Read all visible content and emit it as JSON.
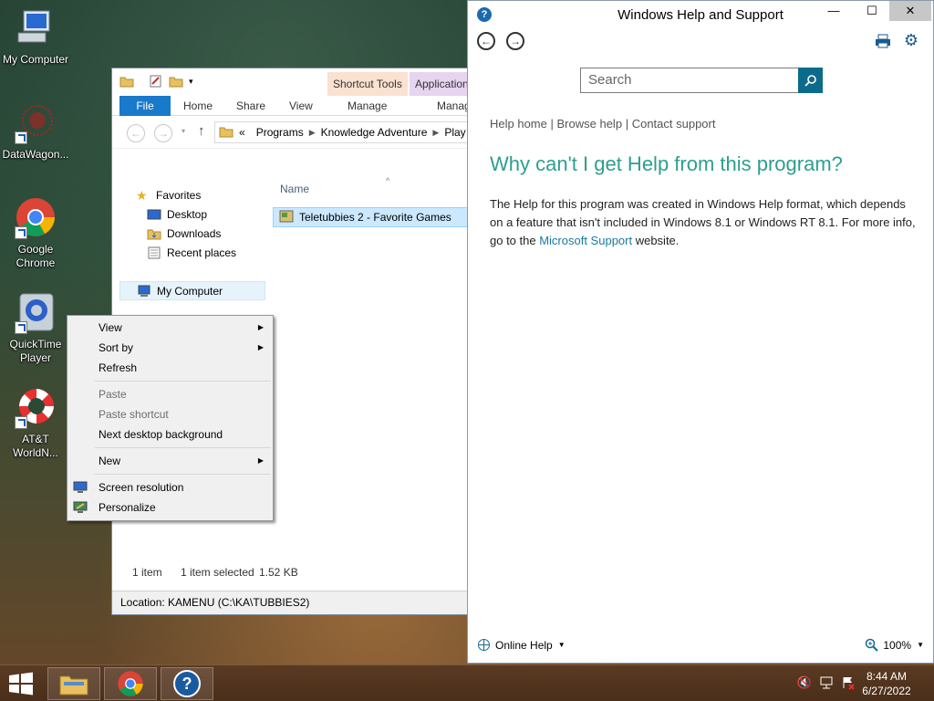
{
  "desktop": {
    "icons": [
      {
        "label": "My Computer",
        "icon": "computer-icon"
      },
      {
        "label": "DataWagon...",
        "icon": "datawagon-icon"
      },
      {
        "label": "Google Chrome",
        "icon": "chrome-icon"
      },
      {
        "label": "QuickTime Player",
        "icon": "quicktime-icon"
      },
      {
        "label": "AT&T WorldN...",
        "icon": "lifebuoy-icon"
      }
    ]
  },
  "explorer": {
    "context_tabs": {
      "shortcut_tools": "Shortcut Tools",
      "application": "Application"
    },
    "ribbon_tabs": {
      "file": "File",
      "home": "Home",
      "share": "Share",
      "view": "View",
      "manage1": "Manage",
      "manage2": "Manag"
    },
    "breadcrumb": {
      "prefix": "«",
      "items": [
        "Programs",
        "Knowledge Adventure",
        "Play"
      ]
    },
    "nav": {
      "favorites": "Favorites",
      "desktop": "Desktop",
      "downloads": "Downloads",
      "recent": "Recent places",
      "my_computer": "My Computer"
    },
    "column_name": "Name",
    "file_name": "Teletubbies 2 - Favorite Games",
    "status": {
      "count": "1 item",
      "selected": "1 item selected",
      "size": "1.52 KB"
    },
    "location": "Location: KAMENU (C:\\KA\\TUBBIES2)"
  },
  "help": {
    "title": "Windows Help and Support",
    "search_placeholder": "Search",
    "links": {
      "home": "Help home",
      "browse": "Browse help",
      "contact": "Contact support",
      "separator": "|"
    },
    "heading": "Why can't I get Help from this program?",
    "body_pre": "The Help for this program was created in Windows Help format, which depends on a feature that isn't included in Windows 8.1 or Windows RT 8.1. For more info, go to the ",
    "body_link": "Microsoft Support",
    "body_post": " website.",
    "footer": {
      "online_help": "Online Help",
      "zoom": "100%"
    },
    "colors": {
      "heading": "#2e9e8f",
      "link": "#1a7aa0",
      "search_button": "#0c6b8a"
    }
  },
  "context_menu": {
    "view": "View",
    "sort_by": "Sort by",
    "refresh": "Refresh",
    "paste": "Paste",
    "paste_shortcut": "Paste shortcut",
    "next_background": "Next desktop background",
    "new": "New",
    "screen_resolution": "Screen resolution",
    "personalize": "Personalize"
  },
  "taskbar": {
    "time": "8:44 AM",
    "date": "6/27/2022",
    "pinned": [
      "file-explorer-icon",
      "chrome-icon",
      "help-icon"
    ]
  }
}
